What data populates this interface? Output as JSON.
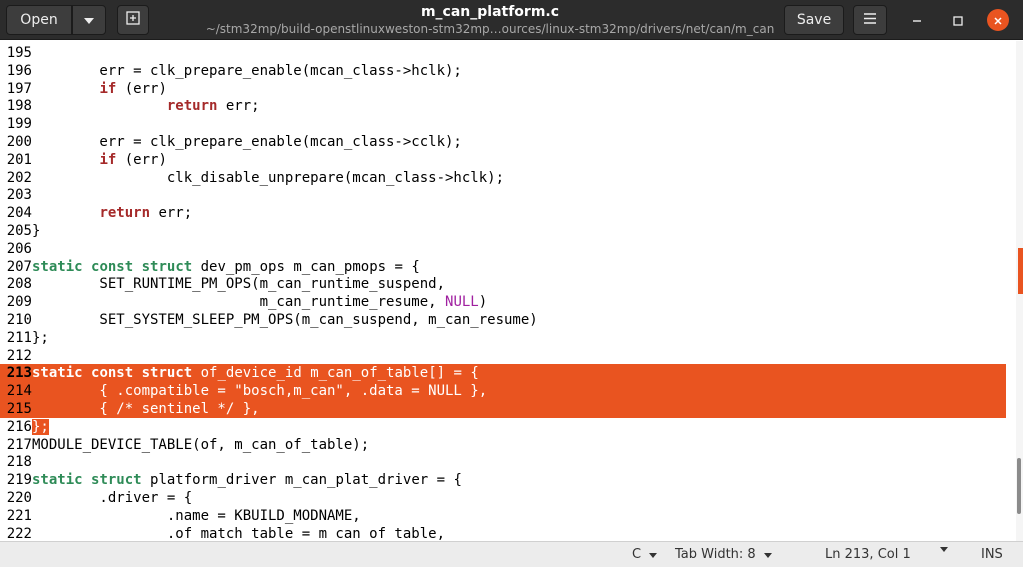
{
  "header": {
    "open_label": "Open",
    "save_label": "Save",
    "title": "m_can_platform.c",
    "subtitle": "~/stm32mp/build-openstlinuxweston-stm32mp…ources/linux-stm32mp/drivers/net/can/m_can",
    "icons": [
      "chevron-down-icon",
      "new-tab-icon",
      "hamburger-menu-icon",
      "minimize-icon",
      "maximize-icon",
      "close-icon"
    ]
  },
  "editor": {
    "lines": [
      {
        "n": "195",
        "parts": []
      },
      {
        "n": "196",
        "parts": [
          [
            "",
            "        err = clk_prepare_enable(mcan_class->hclk);"
          ]
        ]
      },
      {
        "n": "197",
        "parts": [
          [
            "",
            "        "
          ],
          [
            "kw-flow",
            "if"
          ],
          [
            "",
            " (err)"
          ]
        ]
      },
      {
        "n": "198",
        "parts": [
          [
            "",
            "                "
          ],
          [
            "kw-flow",
            "return"
          ],
          [
            "",
            " err;"
          ]
        ]
      },
      {
        "n": "199",
        "parts": []
      },
      {
        "n": "200",
        "parts": [
          [
            "",
            "        err = clk_prepare_enable(mcan_class->cclk);"
          ]
        ]
      },
      {
        "n": "201",
        "parts": [
          [
            "",
            "        "
          ],
          [
            "kw-flow",
            "if"
          ],
          [
            "",
            " (err)"
          ]
        ]
      },
      {
        "n": "202",
        "parts": [
          [
            "",
            "                clk_disable_unprepare(mcan_class->hclk);"
          ]
        ]
      },
      {
        "n": "203",
        "parts": []
      },
      {
        "n": "204",
        "parts": [
          [
            "",
            "        "
          ],
          [
            "kw-flow",
            "return"
          ],
          [
            "",
            " err;"
          ]
        ]
      },
      {
        "n": "205",
        "parts": [
          [
            "",
            "}"
          ]
        ]
      },
      {
        "n": "206",
        "parts": []
      },
      {
        "n": "207",
        "parts": [
          [
            "kw-type",
            "static"
          ],
          [
            "",
            " "
          ],
          [
            "kw-type",
            "const"
          ],
          [
            "",
            " "
          ],
          [
            "kw-type",
            "struct"
          ],
          [
            "",
            " dev_pm_ops m_can_pmops = {"
          ]
        ]
      },
      {
        "n": "208",
        "parts": [
          [
            "",
            "        SET_RUNTIME_PM_OPS(m_can_runtime_suspend,"
          ]
        ]
      },
      {
        "n": "209",
        "parts": [
          [
            "",
            "                           m_can_runtime_resume, "
          ],
          [
            "kw-const",
            "NULL"
          ],
          [
            "",
            ")"
          ]
        ]
      },
      {
        "n": "210",
        "parts": [
          [
            "",
            "        SET_SYSTEM_SLEEP_PM_OPS(m_can_suspend, m_can_resume)"
          ]
        ]
      },
      {
        "n": "211",
        "parts": [
          [
            "",
            "};"
          ]
        ]
      },
      {
        "n": "212",
        "parts": []
      },
      {
        "n": "213",
        "parts": [
          [
            "kw-type",
            "static"
          ],
          [
            "",
            " "
          ],
          [
            "kw-type",
            "const"
          ],
          [
            "",
            " "
          ],
          [
            "kw-type",
            "struct"
          ],
          [
            "",
            " of_device_id m_can_of_table[] = {"
          ]
        ],
        "sel": true,
        "cur": true
      },
      {
        "n": "214",
        "parts": [
          [
            "",
            "        { .compatible = \"bosch,m_can\", .data = NULL },"
          ]
        ],
        "sel": true
      },
      {
        "n": "215",
        "parts": [
          [
            "",
            "        { /* sentinel */ },"
          ]
        ],
        "sel": true
      },
      {
        "n": "216",
        "parts": [
          [
            "",
            "};"
          ]
        ],
        "partial": true
      },
      {
        "n": "217",
        "parts": [
          [
            "",
            "MODULE_DEVICE_TABLE(of, m_can_of_table);"
          ]
        ]
      },
      {
        "n": "218",
        "parts": []
      },
      {
        "n": "219",
        "parts": [
          [
            "kw-type",
            "static"
          ],
          [
            "",
            " "
          ],
          [
            "kw-type",
            "struct"
          ],
          [
            "",
            " platform_driver m_can_plat_driver = {"
          ]
        ]
      },
      {
        "n": "220",
        "parts": [
          [
            "",
            "        .driver = {"
          ]
        ]
      },
      {
        "n": "221",
        "parts": [
          [
            "",
            "                .name = KBUILD_MODNAME,"
          ]
        ]
      },
      {
        "n": "222",
        "parts": [
          [
            "",
            "                .of_match_table = m_can_of_table,"
          ]
        ]
      }
    ]
  },
  "statusbar": {
    "language": "C",
    "tab_width": "Tab Width: 8",
    "position": "Ln 213, Col 1",
    "mode": "INS"
  },
  "colors": {
    "selection": "#e95420",
    "keyword_type": "#2e8b57",
    "keyword_flow": "#a52a2a",
    "constant": "#a020a0",
    "headerbar": "#2c2c2c"
  }
}
